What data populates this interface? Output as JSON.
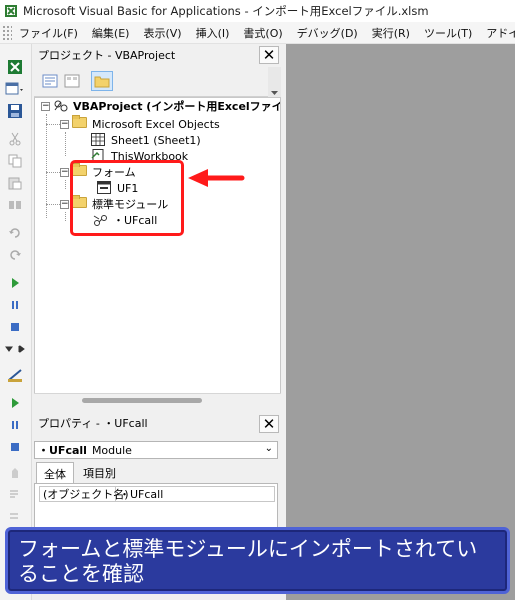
{
  "window": {
    "title": "Microsoft Visual Basic for Applications - インポート用Excelファイル.xlsm"
  },
  "menu": [
    "ファイル(F)",
    "編集(E)",
    "表示(V)",
    "挿入(I)",
    "書式(O)",
    "デバッグ(D)",
    "実行(R)",
    "ツール(T)",
    "アドイン(A)"
  ],
  "project_panel": {
    "title": "プロジェクト - VBAProject",
    "tree": {
      "root": "VBAProject (インポート用Excelファイル.xlsm)",
      "excel_objects": "Microsoft Excel Objects",
      "sheet1": "Sheet1 (Sheet1)",
      "workbook": "ThisWorkbook",
      "forms": "フォーム",
      "form1": "UF1",
      "modules": "標準モジュール",
      "module1": "・UFcall"
    }
  },
  "properties_panel": {
    "title": "プロパティ - ・UFcall",
    "object_name": "・UFcall",
    "object_type": "Module",
    "tabs": [
      "全体",
      "項目別"
    ],
    "rows": [
      {
        "name": "(オブジェクト名)",
        "value": "・UFcall"
      }
    ]
  },
  "annotation": {
    "caption": "フォームと標準モジュールにインポートされていることを確認",
    "highlight_color": "#ff1a1a",
    "caption_bg": "#2b3a9e"
  }
}
